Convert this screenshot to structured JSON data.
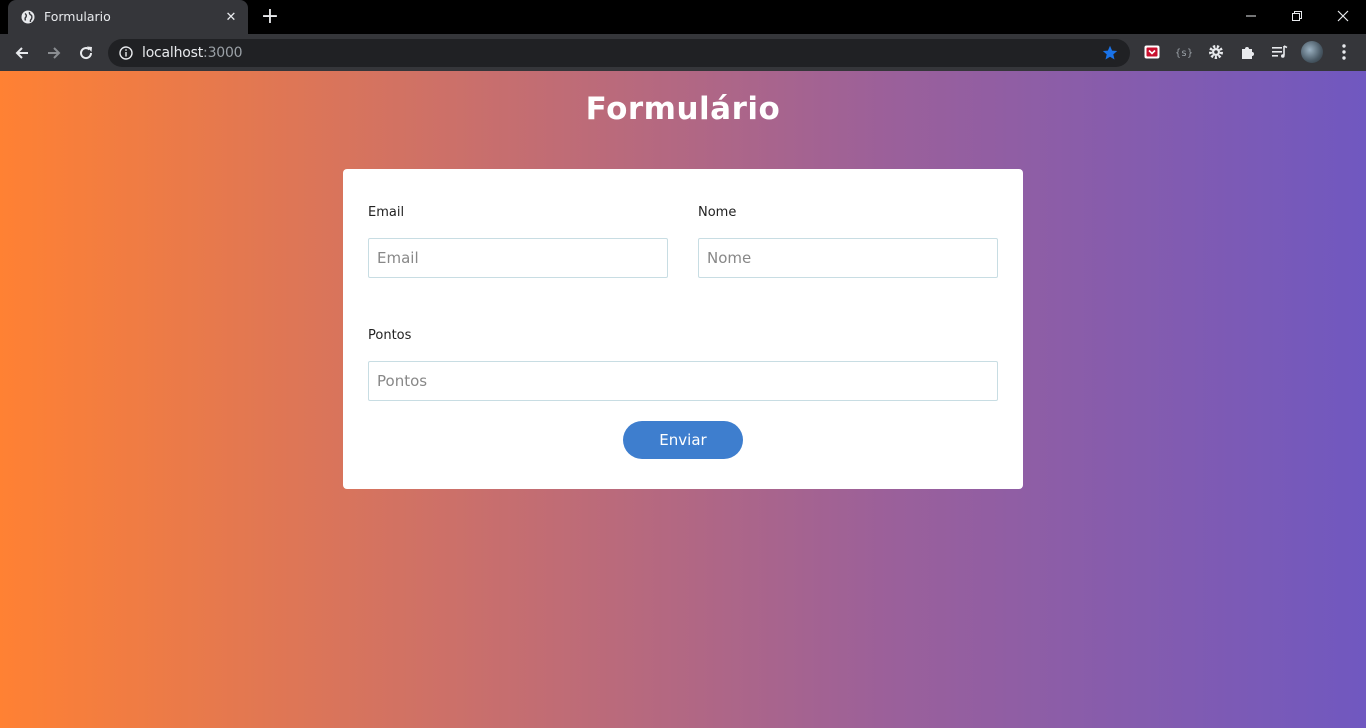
{
  "browser": {
    "tab_title": "Formulario",
    "tab_close_glyph": "✕",
    "new_tab_glyph": "+",
    "url_host": "localhost",
    "url_port": ":3000",
    "icons": {
      "favicon": "globe-icon",
      "back": "arrow-left-icon",
      "forward": "arrow-right-icon",
      "reload": "reload-icon",
      "site_info": "info-icon",
      "bookmark": "star-icon",
      "bookmark_color": "#1a73e8",
      "extensions": [
        "pocket-icon",
        "json-viewer-icon",
        "gear-icon",
        "puzzle-icon",
        "media-playlist-icon"
      ],
      "menu": "kebab-menu-icon"
    }
  },
  "page": {
    "title": "Formulário",
    "gradient": [
      "#ff8133",
      "#7058c0"
    ],
    "form": {
      "email_label": "Email",
      "email_placeholder": "Email",
      "nome_label": "Nome",
      "nome_placeholder": "Nome",
      "pontos_label": "Pontos",
      "pontos_placeholder": "Pontos",
      "submit_label": "Enviar",
      "submit_color": "#3e7ece"
    }
  }
}
